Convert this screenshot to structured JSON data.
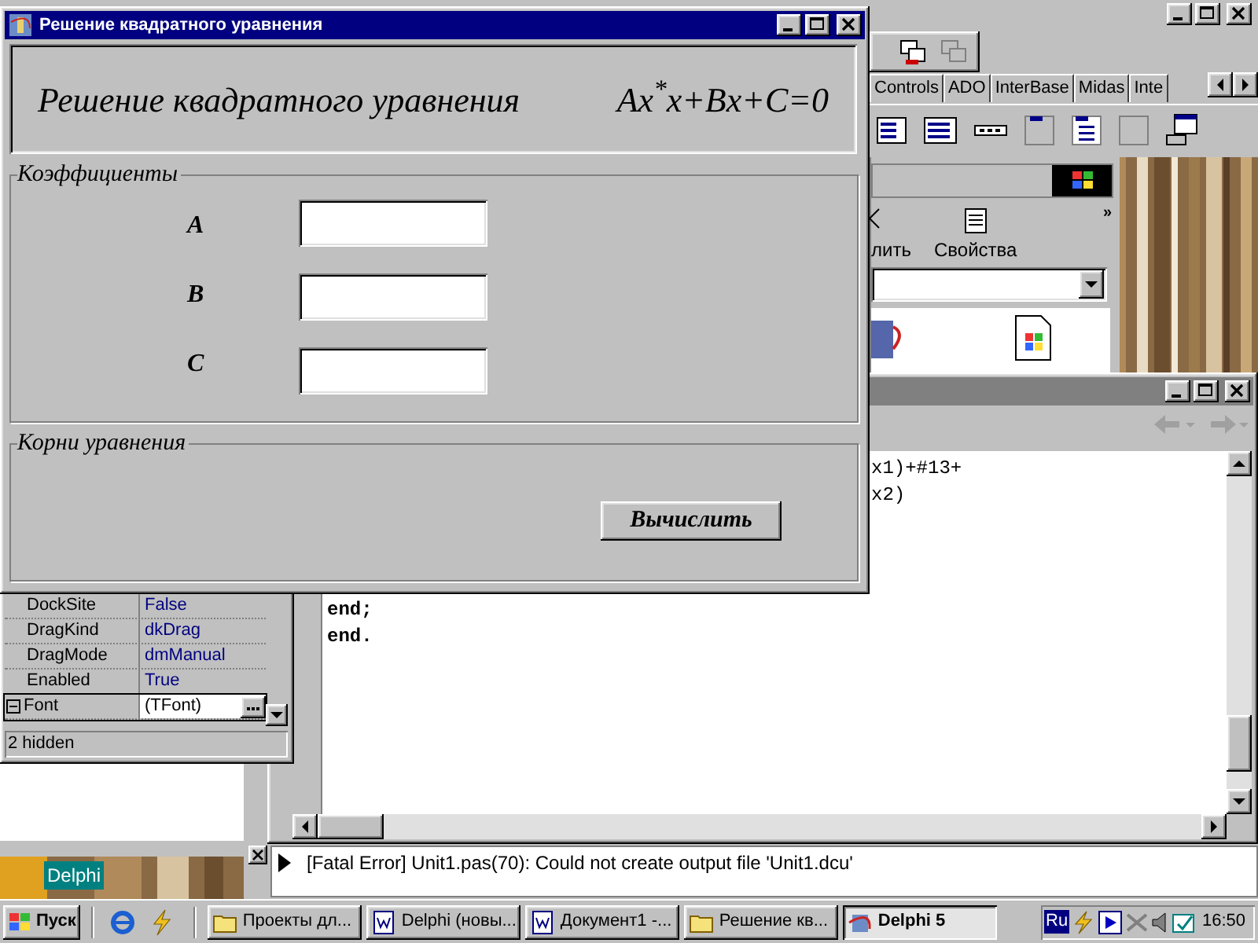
{
  "dialog": {
    "title": "Решение квадратного уравнения",
    "header": {
      "title": "Решение квадратного уравнения",
      "formula": "Ax$^{*}$x+Bx+C=0"
    },
    "coefficients": {
      "caption": "Коэффициенты",
      "fields": [
        {
          "label": "A"
        },
        {
          "label": "B"
        },
        {
          "label": "C"
        }
      ]
    },
    "roots": {
      "caption": "Корни уравнения",
      "button": "Вычислить"
    }
  },
  "palette_tabs": [
    "Controls",
    "ADO",
    "InterBase",
    "Midas",
    "Inte"
  ],
  "explorer": {
    "buttons": [
      "лить",
      "Свойства"
    ],
    "more": "»"
  },
  "editor": {
    "fragments": [
      "x1)+#13+",
      "x2)"
    ],
    "lines": [
      "end;",
      "end."
    ]
  },
  "messages": [
    "[Fatal Error] Unit1.pas(70): Could not create output file 'Unit1.dcu'"
  ],
  "inspector": {
    "rows": [
      {
        "name": "DockSite",
        "value": "False",
        "selected": false,
        "expandable": false
      },
      {
        "name": "DragKind",
        "value": "dkDrag",
        "selected": false,
        "expandable": false
      },
      {
        "name": "DragMode",
        "value": "dmManual",
        "selected": false,
        "expandable": false
      },
      {
        "name": "Enabled",
        "value": "True",
        "selected": false,
        "expandable": false
      },
      {
        "name": "Font",
        "value": "(TFont)",
        "selected": true,
        "expandable": true
      }
    ],
    "status": "2 hidden"
  },
  "desktop_icon_label": "Delphi",
  "taskbar": {
    "start": "Пуск",
    "tasks": [
      {
        "label": "Проекты дл...",
        "kind": "folder",
        "selected": false
      },
      {
        "label": "Delphi (новы...",
        "kind": "document",
        "selected": false
      },
      {
        "label": "Документ1 -...",
        "kind": "document",
        "selected": false
      },
      {
        "label": "Решение кв...",
        "kind": "folder",
        "selected": false
      },
      {
        "label": "Delphi 5",
        "kind": "application",
        "selected": true
      }
    ],
    "language": "Ru",
    "clock": "16:50"
  }
}
